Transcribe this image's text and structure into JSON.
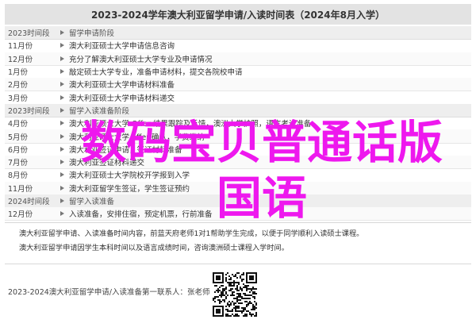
{
  "header": {
    "title": "2023-2024学年澳大利亚留学申请/入读时间表（2024年8月入学）"
  },
  "table": {
    "rows": [
      {
        "type": "section",
        "date": "2023时间段",
        "event": "留学申请阶段"
      },
      {
        "type": "item",
        "date": "11月份",
        "event": "澳大利亚硕士大学申请信息咨询"
      },
      {
        "type": "item",
        "date": "12月份",
        "event": "充分了解澳大利亚硕士大学专业及申请情况"
      },
      {
        "type": "item",
        "date": "1月份",
        "event": "敲定硕士大学专业，准备申请材料，提交各院校申请"
      },
      {
        "type": "item",
        "date": "2月份",
        "event": "澳大利亚硕士大学申请材料准备"
      },
      {
        "type": "item",
        "date": "3月份",
        "event": "澳大利亚硕士大学申请材料递交"
      },
      {
        "type": "section",
        "date": "2023时间段",
        "event": "留学入读准备阶段"
      },
      {
        "type": "item",
        "date": "4月份",
        "event": "澳大利亚硕士大学 Offer 结果跟踪及反馈，澳洲大学护照，语言考试准备"
      },
      {
        "type": "item",
        "date": "5月份",
        "event": "澳大利亚硕士大学 offer 确认，学费缴纳"
      },
      {
        "type": "item",
        "date": "6月份",
        "event": "澳大利亚签证申请，签证材料准备"
      },
      {
        "type": "item",
        "date": "7月份",
        "event": "澳大利亚签证材料递交"
      },
      {
        "type": "item",
        "date": "8月份",
        "event": "澳大利亚硕士大学院校开学报到入学"
      },
      {
        "type": "item",
        "date": "11月份",
        "event": "澳大利亚留学生签证，学生签证预约"
      },
      {
        "type": "section",
        "date": "2024时间段",
        "event": "留学入读准备"
      },
      {
        "type": "item",
        "date": "12月份",
        "event": "入读准备，安排住宿，预定机票，行前准备"
      }
    ]
  },
  "overlay": {
    "line1": "数码宝贝普通话版",
    "line2": "国语"
  },
  "notes": [
    "澳大利亚留学申请、入读准备时间内容，前蓝天府老师1对1帮助学生完成，以便于同学顺利入读硕士课程。",
    "澳大利亚留学申请因学生本科时间以及语言成绩时间，咨询澳洲硕士课程入学时间。"
  ],
  "footer": {
    "text": "2023-2024澳大利亚留学申请/入读准备第一联系人：张老师"
  },
  "colors": {
    "overlay": "#ee18ee",
    "header_bg": "#e3e3e3",
    "section_bg": "#eeeeee"
  }
}
